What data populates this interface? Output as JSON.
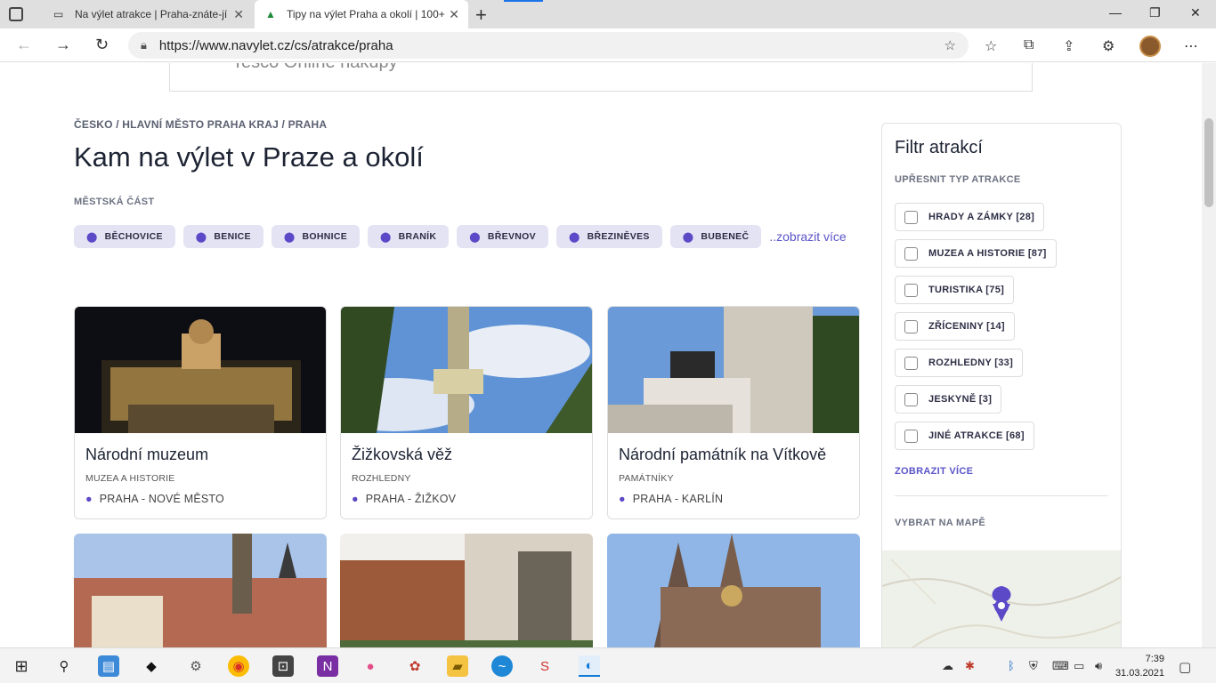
{
  "browser": {
    "tabs": [
      {
        "title": "Na výlet atrakce | Praha-znáte-jí"
      },
      {
        "title": "Tipy na výlet Praha a okolí | 100+"
      }
    ],
    "url": "https://www.navylet.cz/cs/atrakce/praha",
    "icons": [
      "tab-actions-icon",
      "back-icon",
      "forward-icon",
      "refresh-icon",
      "lock-icon",
      "add-favorite-icon",
      "favorites-icon",
      "collections-icon",
      "share-icon",
      "extensions-icon",
      "more-icon"
    ]
  },
  "ad": {
    "text": "Tesco Online nákupy"
  },
  "breadcrumb": "ČESKO / HLAVNÍ MĚSTO PRAHA KRAJ / PRAHA",
  "title": "Kam na výlet v Praze a okolí",
  "district_label": "MĚSTSKÁ ČÁST",
  "districts": [
    "BĚCHOVICE",
    "BENICE",
    "BOHNICE",
    "BRANÍK",
    "BŘEVNOV",
    "BŘEZINĚVES",
    "BUBENEČ"
  ],
  "show_more": "..zobrazit více",
  "cards": [
    {
      "title": "Národní muzeum",
      "category": "MUZEA A HISTORIE",
      "location": "PRAHA - NOVÉ MĚSTO"
    },
    {
      "title": "Žižkovská věž",
      "category": "ROZHLEDNY",
      "location": "PRAHA - ŽIŽKOV"
    },
    {
      "title": "Národní památník na Vítkově",
      "category": "PAMÁTNÍKY",
      "location": "PRAHA - KARLÍN"
    }
  ],
  "sidebar": {
    "title": "Filtr atrakcí",
    "subtitle": "UPŘESNIT TYP ATRAKCE",
    "filters": [
      {
        "label": "HRADY A ZÁMKY [28]"
      },
      {
        "label": "MUZEA A HISTORIE [87]"
      },
      {
        "label": "TURISTIKA [75]"
      },
      {
        "label": "ZŘÍCENINY [14]"
      },
      {
        "label": "ROZHLEDNY [33]"
      },
      {
        "label": "JESKYNĚ [3]"
      },
      {
        "label": "JINÉ ATRAKCE [68]"
      }
    ],
    "more": "ZOBRAZIT VÍCE",
    "map_label": "VYBRAT NA MAPĚ"
  },
  "taskbar": {
    "time": "7:39",
    "date": "31.03.2021"
  },
  "colors": {
    "accent": "#5b49c7",
    "chip_bg": "#e4e3f4",
    "link": "#5b55c9"
  }
}
